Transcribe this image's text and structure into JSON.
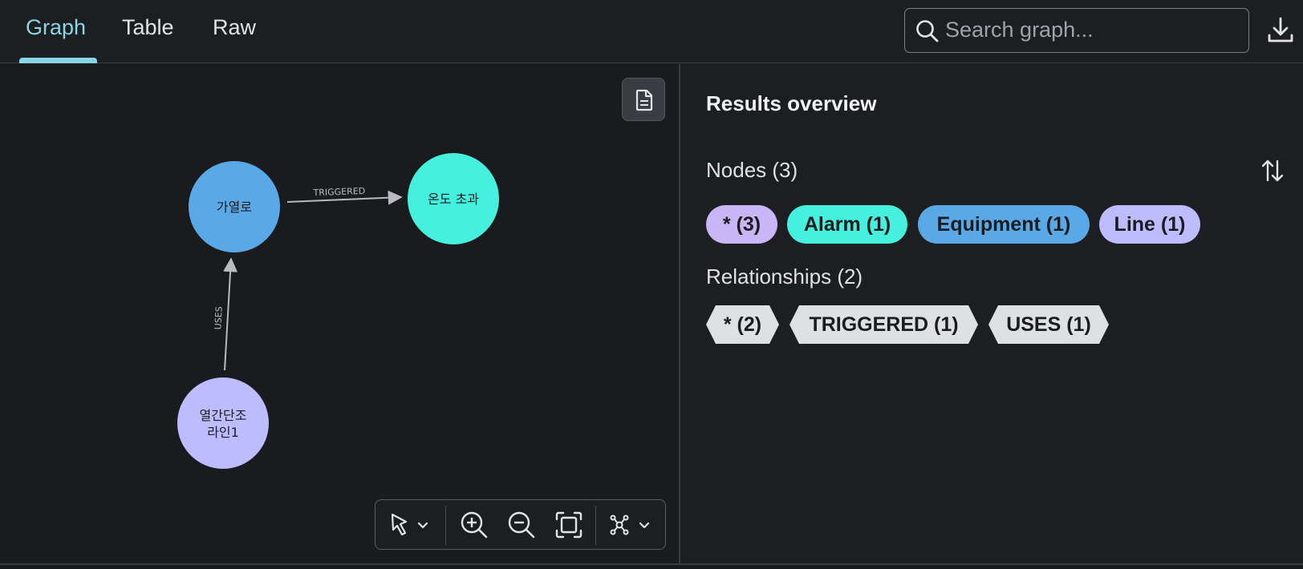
{
  "tabs": [
    {
      "label": "Graph",
      "active": true
    },
    {
      "label": "Table",
      "active": false
    },
    {
      "label": "Raw",
      "active": false
    }
  ],
  "search": {
    "placeholder": "Search graph..."
  },
  "graph": {
    "nodes": [
      {
        "id": "heater",
        "label": "가열로",
        "category": "Equipment",
        "color": "#5aa9e6"
      },
      {
        "id": "alarm",
        "label": "온도 초과",
        "category": "Alarm",
        "color": "#45f0df"
      },
      {
        "id": "line",
        "label_lines": [
          "열간단조",
          "라인1"
        ],
        "category": "Line",
        "color": "#bdbcff"
      }
    ],
    "relationships": [
      {
        "type": "TRIGGERED",
        "from": "heater",
        "to": "alarm"
      },
      {
        "type": "USES",
        "from": "line",
        "to": "heater"
      }
    ]
  },
  "results": {
    "title": "Results overview",
    "nodes_label": "Nodes (3)",
    "node_chips": [
      {
        "label": "* (3)",
        "color": "#c9b6f6"
      },
      {
        "label": "Alarm (1)",
        "color": "#45f0df"
      },
      {
        "label": "Equipment (1)",
        "color": "#5aa9e6"
      },
      {
        "label": "Line (1)",
        "color": "#bdbcff"
      }
    ],
    "relationships_label": "Relationships (2)",
    "relationship_chips": [
      {
        "label": "* (2)"
      },
      {
        "label": "TRIGGERED (1)"
      },
      {
        "label": "USES (1)"
      }
    ]
  },
  "icons": {
    "search": "search-icon",
    "download": "download-icon",
    "document": "document-icon",
    "sort": "sort-icon",
    "select": "cursor-icon",
    "zoom_in": "zoom-in-icon",
    "zoom_out": "zoom-out-icon",
    "fit": "fit-screen-icon",
    "layout": "layout-icon"
  }
}
